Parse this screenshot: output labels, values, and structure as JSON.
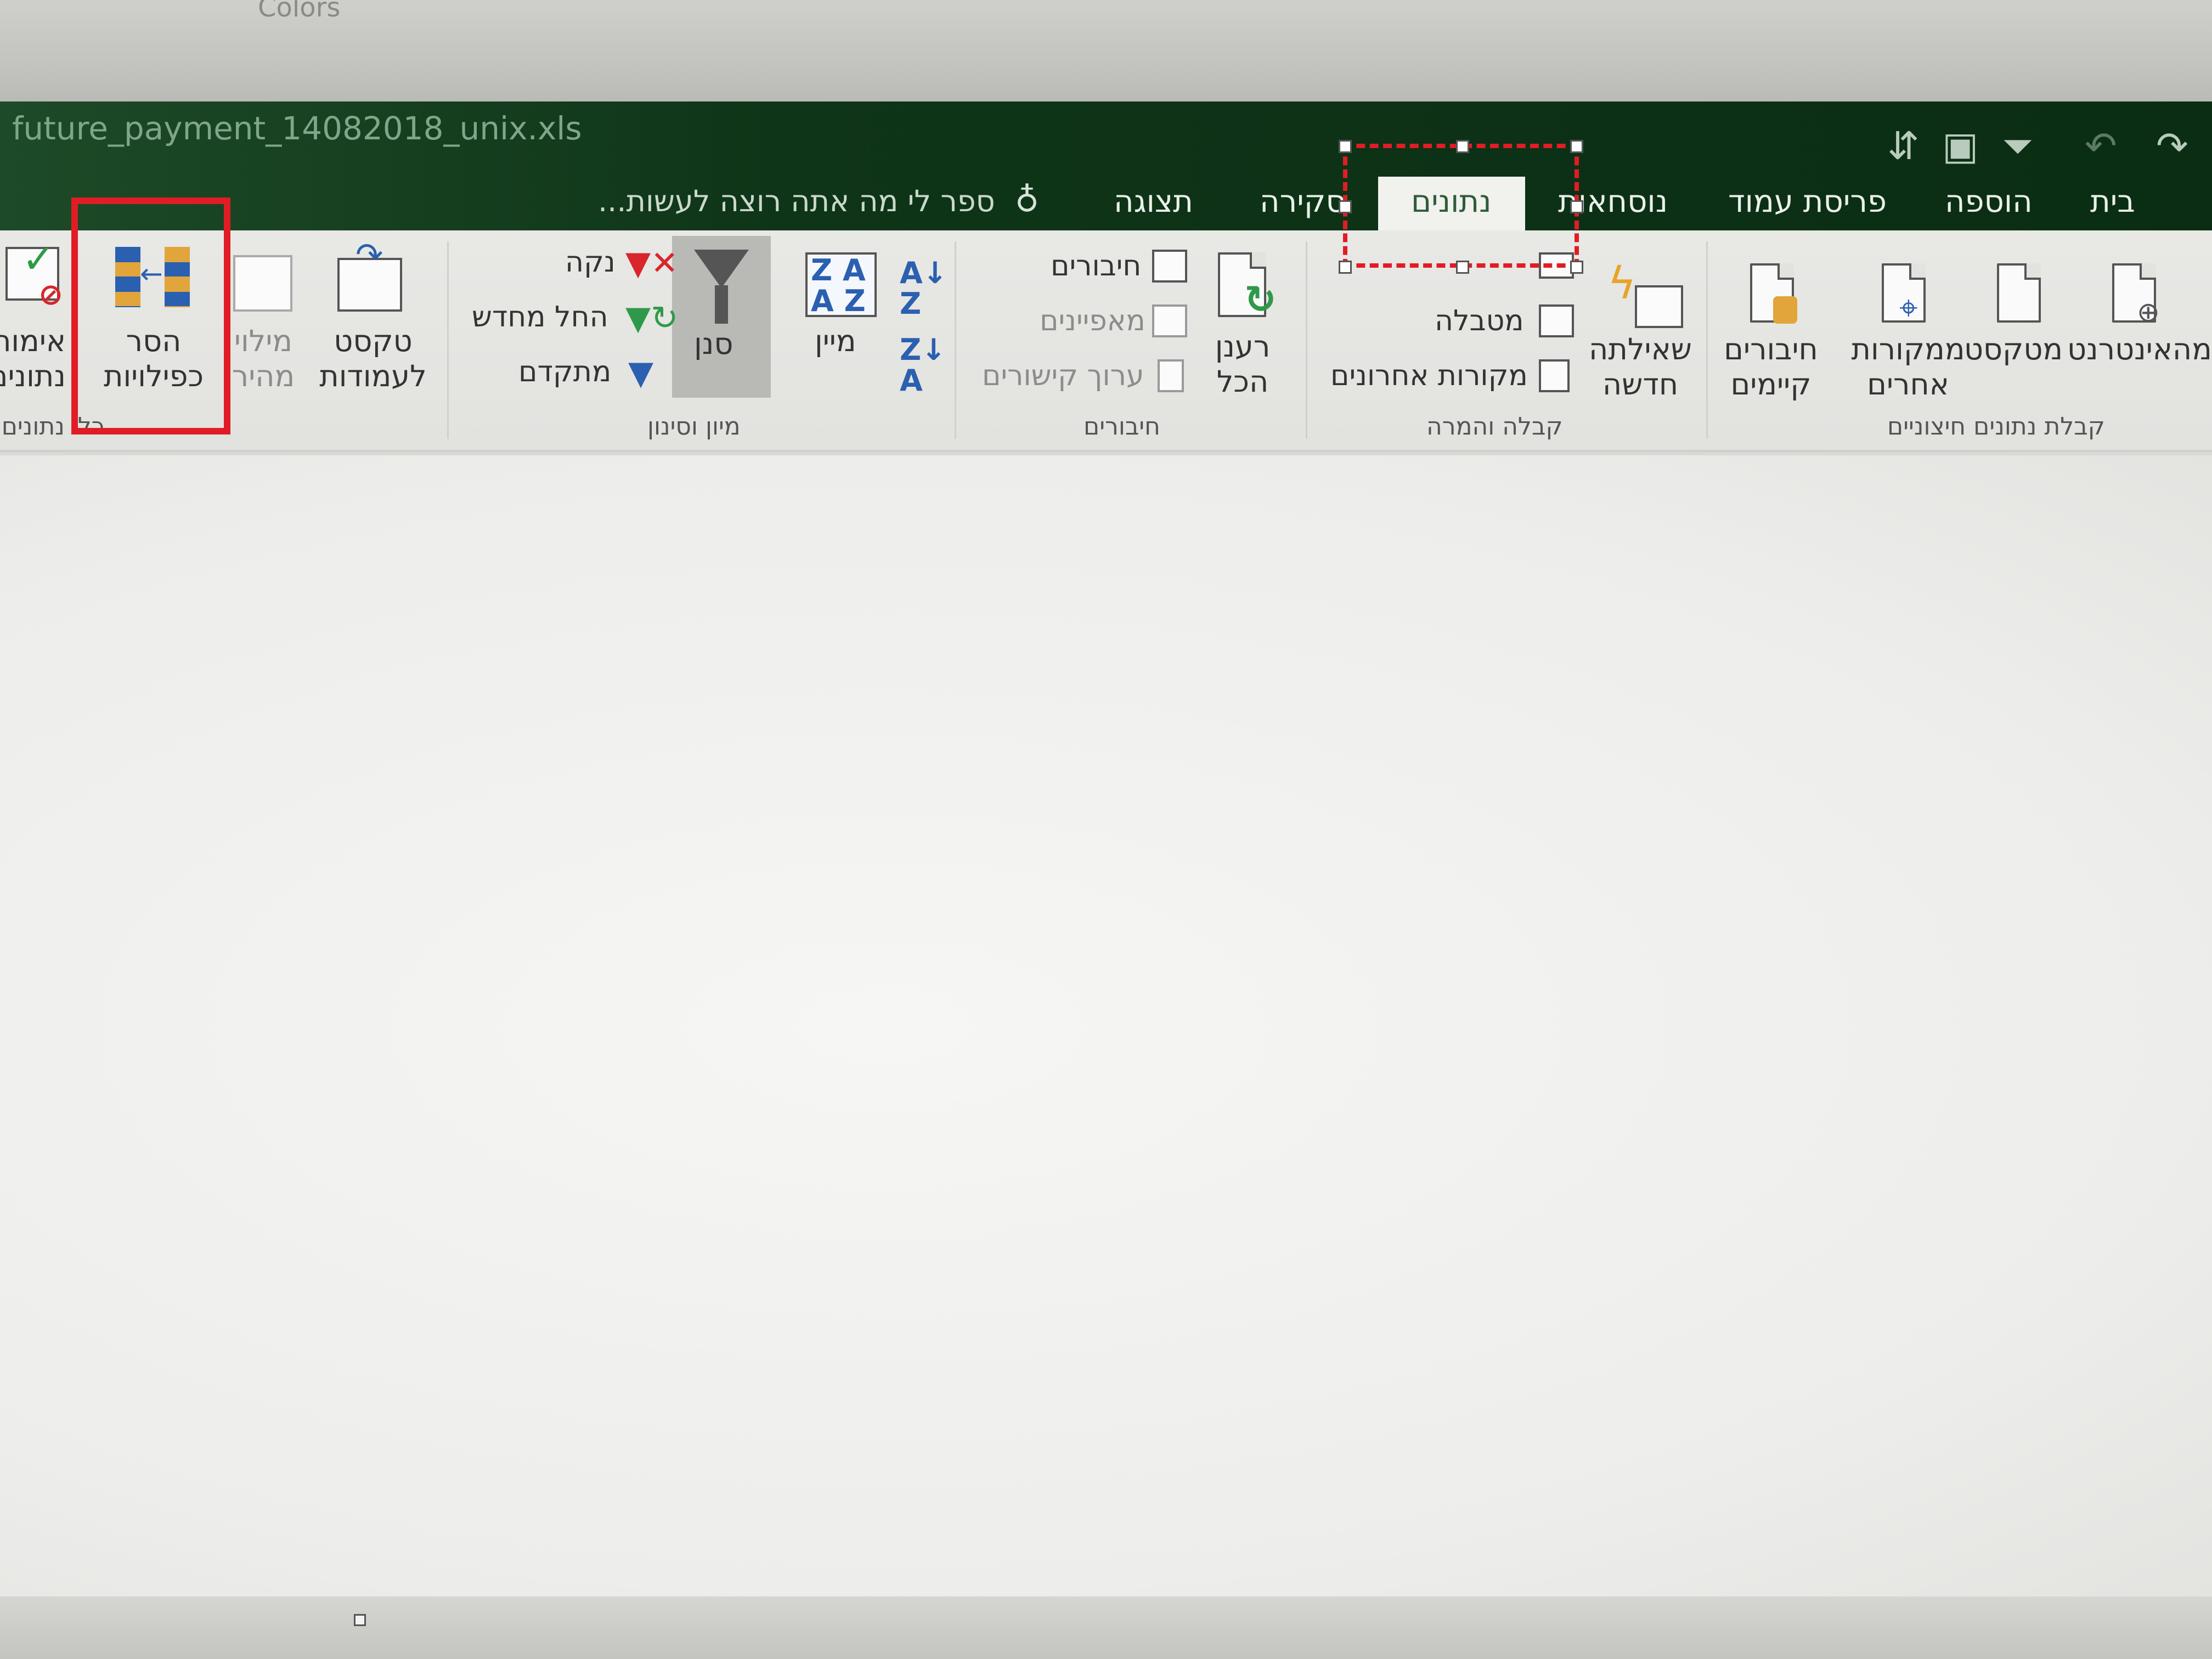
{
  "window": {
    "top_label": "Colors",
    "file_name": "future_payment_14082018_unix.xls"
  },
  "quick_access": {
    "more_icon": "customize-qat-icon",
    "symbols": [
      "⇵",
      "▣",
      "⏷",
      "↶",
      "↷"
    ]
  },
  "tabs": [
    {
      "label": "בית"
    },
    {
      "label": "הוספה"
    },
    {
      "label": "פריסת עמוד"
    },
    {
      "label": "נוסחאות"
    },
    {
      "label": "נתונים"
    },
    {
      "label": "סקירה"
    },
    {
      "label": "תצוגה"
    }
  ],
  "tell_me": "ספר לי מה אתה רוצה לעשות...",
  "groups": {
    "get_external_data": {
      "title": "קבלת נתונים חיצוניים",
      "from_web": "מהאינטרנט",
      "from_text": "מטקסט",
      "other_sources": "ממקורות אחרים",
      "existing_connections": "חיבורים קיימים"
    },
    "get_transform": {
      "title": "קבלה והמרה",
      "new_query": "שאילתה חדשה",
      "from_table": "מטבלה",
      "recent_sources": "מקורות אחרונים"
    },
    "connections": {
      "title": "חיבורים",
      "refresh_all": "רענן הכל",
      "connections": "חיבורים",
      "properties": "מאפיינים",
      "edit_links": "ערוך קישורים"
    },
    "sort_filter": {
      "title": "מיון וסינון",
      "sort": "מיין",
      "filter": "סנן",
      "clear": "נקה",
      "reapply": "החל מחדש",
      "advanced": "מתקדם"
    },
    "data_tools": {
      "title": "כלי נתונים",
      "text_to_columns": "טקסט לעמודות",
      "flash_fill": "מילוי מהיר",
      "remove_duplicates": "הסר כפילויות",
      "data_validation": "אימות נתונים"
    }
  },
  "annotations": {
    "highlight_color": "#e01d25"
  }
}
